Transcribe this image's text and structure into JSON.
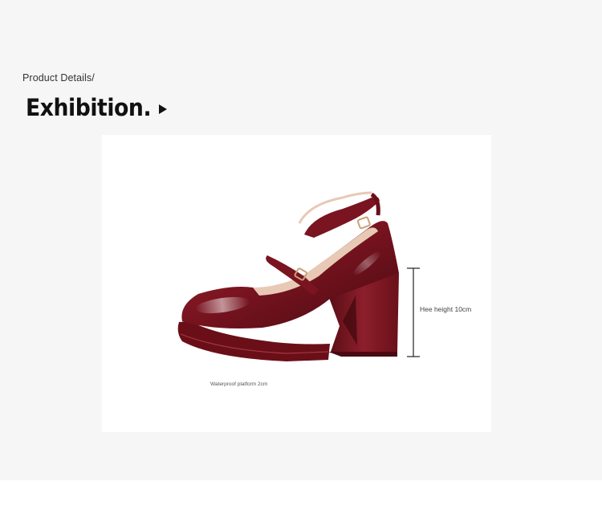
{
  "breadcrumb": "Product Details/",
  "title": "Exhibition.",
  "title_arrow_icon": "play-triangle-icon",
  "product_image": {
    "alt": "Burgundy patent leather Mary Jane platform pump with double ankle strap",
    "shoe_color": "#7a1420",
    "lining_color": "#e8c9b6",
    "buckle_color": "#c9a27a"
  },
  "annotations": {
    "heel_height": "Hee height 10cm",
    "platform": "Waterproof platform 2cm"
  }
}
